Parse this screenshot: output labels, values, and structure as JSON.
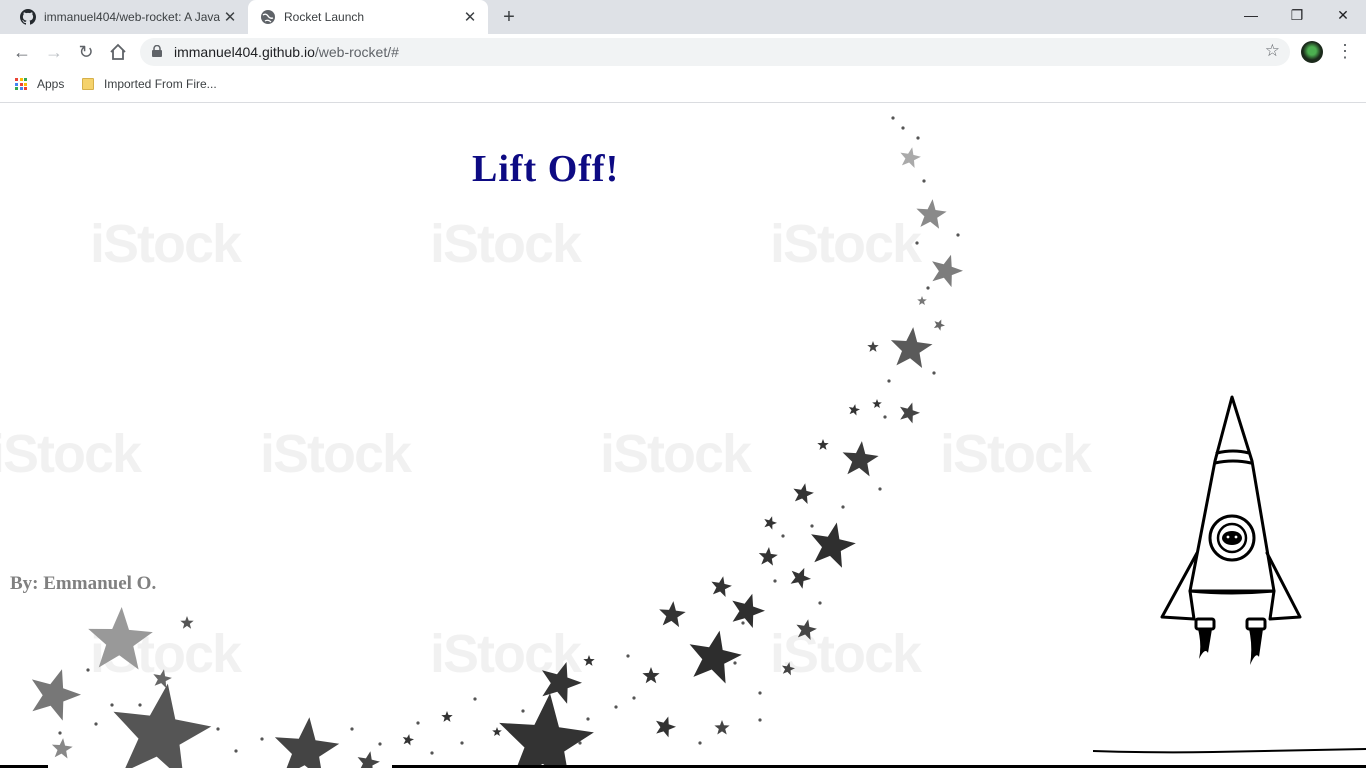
{
  "browser": {
    "tabs": [
      {
        "title": "immanuel404/web-rocket: A Java",
        "icon": "github-icon",
        "active": false
      },
      {
        "title": "Rocket Launch",
        "icon": "globe-icon",
        "active": true
      }
    ],
    "new_tab_label": "+",
    "url_domain": "immanuel404.github.io",
    "url_path": "/web-rocket/#",
    "bookmarks": [
      {
        "label": "Apps",
        "icon": "apps-grid-icon"
      },
      {
        "label": "Imported From Fire...",
        "icon": "folder-icon"
      }
    ]
  },
  "page": {
    "heading": "Lift Off!",
    "byline": "By: Emmanuel O.",
    "heading_color": "#0d0a83",
    "byline_color": "#808080"
  }
}
